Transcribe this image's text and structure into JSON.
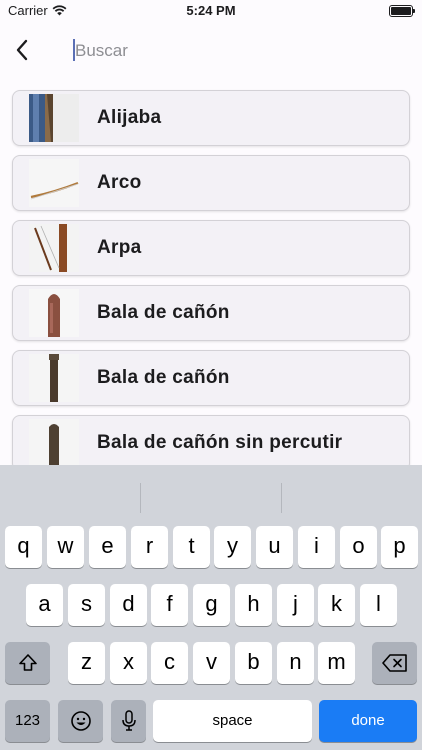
{
  "status_bar": {
    "carrier": "Carrier",
    "time": "5:24 PM"
  },
  "search": {
    "placeholder": "Buscar",
    "value": ""
  },
  "items": [
    {
      "label": "Alijaba"
    },
    {
      "label": "Arco"
    },
    {
      "label": "Arpa"
    },
    {
      "label": "Bala de cañón"
    },
    {
      "label": "Bala de cañón"
    },
    {
      "label": "Bala de cañón sin percutir"
    }
  ],
  "keyboard": {
    "row1": [
      "q",
      "w",
      "e",
      "r",
      "t",
      "y",
      "u",
      "i",
      "o",
      "p"
    ],
    "row2": [
      "a",
      "s",
      "d",
      "f",
      "g",
      "h",
      "j",
      "k",
      "l"
    ],
    "row3": [
      "z",
      "x",
      "c",
      "v",
      "b",
      "n",
      "m"
    ],
    "numbers_label": "123",
    "space_label": "space",
    "done_label": "done"
  },
  "colors": {
    "accent": "#1a7cf5",
    "card": "#f3f1f6",
    "keyboard_bg": "#d1d4da"
  }
}
